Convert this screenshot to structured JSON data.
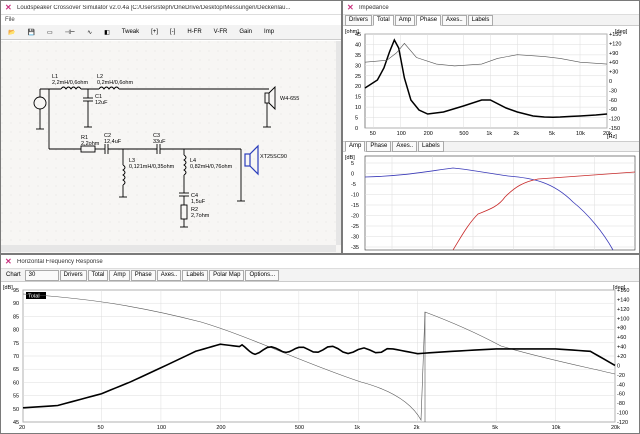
{
  "sim": {
    "title": "Loudspeaker Crossover Simulator v2.0.4a [C:/Users/steph/OneDrive/Desktop/Messungen/Deckenlau...",
    "menu": "File",
    "toolbar": [
      "Tweak",
      "[+]",
      "[-]",
      "H-FR",
      "V-FR",
      "Gain",
      "Imp"
    ],
    "components": {
      "L1": "L1",
      "L1v": "2,2mH/0,6ohm",
      "L2": "L2",
      "L2v": "0,2mH/0,6ohm",
      "C1": "C1",
      "C1v": "12uF",
      "W": "W4-655",
      "R1": "R1",
      "R1v": "2,2ohm",
      "C2": "C2",
      "C2v": "12,4uF",
      "C3": "C3",
      "C3v": "33uF",
      "L3": "L3",
      "L3v": "0,121mH/0,35ohm",
      "L4": "L4",
      "L4v": "0,82mH/0,76ohm",
      "T": "XT25SC90",
      "C4": "C4",
      "C4v": "1,5uF",
      "R2": "R2",
      "R2v": "2,7ohm"
    }
  },
  "imp": {
    "title": "Impedance",
    "tabs": [
      "Drivers",
      "Total",
      "Amp",
      "Phase",
      "Axes..",
      "Labels"
    ],
    "ylabel_left": "[ohm]",
    "ylabel_right": "[deg]",
    "yticks_left": [
      "45",
      "40",
      "35",
      "30",
      "25",
      "20",
      "15",
      "10",
      "5",
      "0"
    ],
    "yticks_right": [
      "+150",
      "+120",
      "+90",
      "+60",
      "+30",
      "0",
      "-30",
      "-60",
      "-90",
      "-120",
      "-150"
    ],
    "xticks": [
      "50",
      "100",
      "200",
      "500",
      "1k",
      "2k",
      "5k",
      "10k",
      "20k"
    ],
    "xunit": "Hz"
  },
  "xo": {
    "tabs": [
      "Amp",
      "Phase",
      "Axes..",
      "Labels"
    ],
    "ylabel": "[dB]",
    "yticks": [
      "5",
      "0",
      "-5",
      "-10",
      "-15",
      "-20",
      "-25",
      "-30",
      "-35"
    ]
  },
  "hfr": {
    "title": "Horizontal Frequency Response",
    "chart_label": "Chart",
    "chart_value": "30",
    "tabs": [
      "Drivers",
      "Total",
      "Amp",
      "Phase",
      "Axes..",
      "Labels",
      "Polar Map",
      "Options..."
    ],
    "legend": "Total",
    "ylabel_left": "[dB]",
    "ylabel_right": "[deg]",
    "yticks_left": [
      "95",
      "90",
      "85",
      "80",
      "75",
      "70",
      "65",
      "60",
      "55",
      "50",
      "45"
    ],
    "yticks_right": [
      "+160",
      "+140",
      "+120",
      "+100",
      "+80",
      "+60",
      "+40",
      "+20",
      "0",
      "-20",
      "-40",
      "-60",
      "-80",
      "-100",
      "-120"
    ],
    "xticks": [
      "20",
      "50",
      "100",
      "200",
      "500",
      "1k",
      "2k",
      "5k",
      "10k",
      "20k"
    ]
  },
  "chart_data": [
    {
      "type": "line",
      "title": "Impedance",
      "ylabel": "[ohm]",
      "y2label": "[deg]",
      "xlim": [
        40,
        20000
      ],
      "ylim": [
        0,
        47
      ],
      "series": [
        {
          "x": [
            40,
            55,
            65,
            75,
            85,
            95,
            110,
            130,
            160,
            200,
            300,
            500,
            800,
            1000,
            1500,
            2000,
            3000,
            4000,
            5000,
            6000,
            8000,
            10000,
            15000,
            20000
          ],
          "y": [
            20,
            24,
            30,
            38,
            44,
            40,
            25,
            14,
            9,
            7,
            8,
            11,
            14,
            14,
            10,
            8,
            6,
            5.5,
            5.4,
            5.5,
            5.8,
            6,
            6.5,
            7
          ]
        }
      ]
    },
    {
      "type": "line",
      "title": "Horizontal Frequency Response",
      "ylabel": "[dB]",
      "y2label": "[deg]",
      "xlim": [
        20,
        20000
      ],
      "ylim": [
        41,
        97
      ],
      "series": [
        {
          "name": "Total",
          "x": [
            20,
            30,
            50,
            70,
            100,
            150,
            200,
            250,
            300,
            400,
            500,
            700,
            1000,
            1500,
            2000,
            3000,
            5000,
            7000,
            10000,
            15000,
            20000
          ],
          "y": [
            47,
            48,
            53,
            58,
            64,
            71,
            74,
            73,
            71,
            72,
            71.5,
            72,
            71,
            72,
            70,
            71,
            72,
            72,
            72,
            71,
            65
          ]
        }
      ]
    }
  ]
}
